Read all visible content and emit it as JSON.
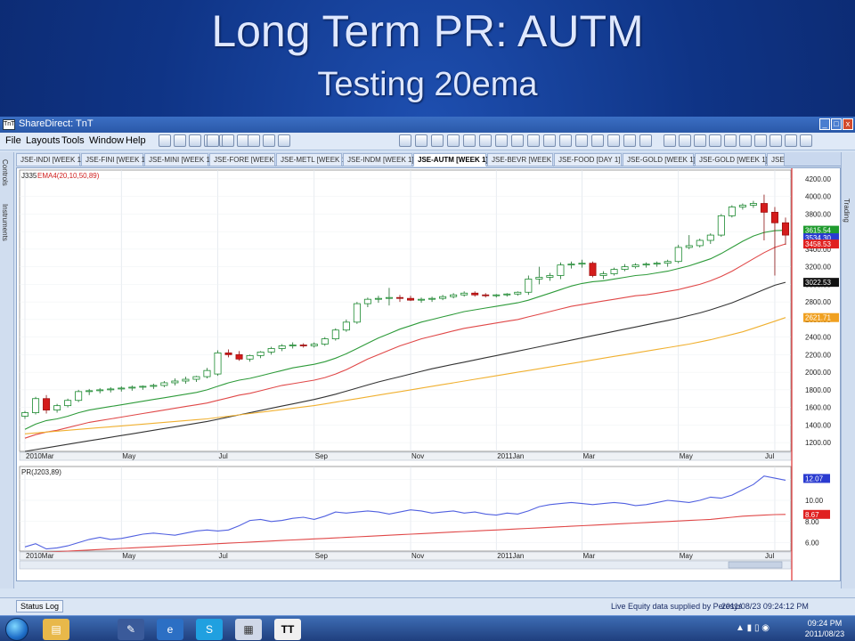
{
  "slide": {
    "title": "Long Term PR: AUTM",
    "subtitle": "Testing 20ema"
  },
  "window": {
    "title": "ShareDirect: TnT",
    "icon_text": "TnT",
    "minimize": "_",
    "maximize": "□",
    "close": "x"
  },
  "menu": [
    "File",
    "Layouts",
    "Tools",
    "Window",
    "Help"
  ],
  "tabs": [
    "JSE-INDI [WEEK 1]",
    "JSE-FINI [WEEK 1]",
    "JSE-MINI [WEEK 1]",
    "JSE-FORE [WEEK 1]",
    "JSE-METL [WEEK 1]",
    "JSE-INDM [WEEK 1]",
    "JSE-AUTM [WEEK 1]",
    "JSE-BEVR [WEEK 1]",
    "JSE-FOOD [DAY 1]",
    "JSE-GOLD [WEEK 1]",
    "JSE-GOLD [WEEK 1]",
    "JSE"
  ],
  "active_tab_index": 6,
  "left_panels": [
    "Controls",
    "Instruments"
  ],
  "right_panels": [
    "Trading"
  ],
  "status": {
    "log_tab": "Status Log",
    "supply": "Live Equity data supplied by Peresys",
    "datetime": "2011/08/23 09:24:12 PM"
  },
  "taskbar": {
    "time": "09:24 PM",
    "date": "2011/08/23"
  },
  "chart_data": [
    {
      "type": "candlestick",
      "symbol_label": "J335",
      "indicator_label": "EMA4(20,10,50,89)",
      "y_ticks": [
        1200,
        1400,
        1600,
        1800,
        2000,
        2200,
        2400,
        2600,
        2800,
        3000,
        3200,
        3400,
        3600,
        3800,
        4000,
        4200
      ],
      "ylim": [
        1100,
        4300
      ],
      "x_ticks": [
        "2010Mar",
        "May",
        "Jul",
        "Sep",
        "Nov",
        "2011Jan",
        "Mar",
        "May",
        "Jul"
      ],
      "candles": [
        {
          "o": 1500,
          "h": 1560,
          "l": 1470,
          "c": 1540
        },
        {
          "o": 1540,
          "h": 1720,
          "l": 1520,
          "c": 1700
        },
        {
          "o": 1700,
          "h": 1740,
          "l": 1530,
          "c": 1570
        },
        {
          "o": 1570,
          "h": 1640,
          "l": 1540,
          "c": 1620
        },
        {
          "o": 1620,
          "h": 1700,
          "l": 1600,
          "c": 1680
        },
        {
          "o": 1680,
          "h": 1800,
          "l": 1660,
          "c": 1780
        },
        {
          "o": 1780,
          "h": 1810,
          "l": 1740,
          "c": 1790
        },
        {
          "o": 1790,
          "h": 1820,
          "l": 1760,
          "c": 1800
        },
        {
          "o": 1800,
          "h": 1830,
          "l": 1770,
          "c": 1810
        },
        {
          "o": 1810,
          "h": 1840,
          "l": 1780,
          "c": 1820
        },
        {
          "o": 1820,
          "h": 1850,
          "l": 1790,
          "c": 1830
        },
        {
          "o": 1830,
          "h": 1850,
          "l": 1800,
          "c": 1840
        },
        {
          "o": 1840,
          "h": 1870,
          "l": 1810,
          "c": 1850
        },
        {
          "o": 1850,
          "h": 1900,
          "l": 1830,
          "c": 1880
        },
        {
          "o": 1880,
          "h": 1930,
          "l": 1850,
          "c": 1900
        },
        {
          "o": 1900,
          "h": 1950,
          "l": 1870,
          "c": 1920
        },
        {
          "o": 1920,
          "h": 1960,
          "l": 1890,
          "c": 1950
        },
        {
          "o": 1950,
          "h": 2050,
          "l": 1930,
          "c": 2020
        },
        {
          "o": 1980,
          "h": 2250,
          "l": 1960,
          "c": 2220
        },
        {
          "o": 2220,
          "h": 2260,
          "l": 2170,
          "c": 2200
        },
        {
          "o": 2200,
          "h": 2240,
          "l": 2130,
          "c": 2150
        },
        {
          "o": 2150,
          "h": 2200,
          "l": 2120,
          "c": 2190
        },
        {
          "o": 2190,
          "h": 2240,
          "l": 2160,
          "c": 2230
        },
        {
          "o": 2230,
          "h": 2290,
          "l": 2200,
          "c": 2270
        },
        {
          "o": 2270,
          "h": 2320,
          "l": 2240,
          "c": 2300
        },
        {
          "o": 2300,
          "h": 2340,
          "l": 2270,
          "c": 2310
        },
        {
          "o": 2310,
          "h": 2330,
          "l": 2280,
          "c": 2300
        },
        {
          "o": 2300,
          "h": 2340,
          "l": 2280,
          "c": 2320
        },
        {
          "o": 2320,
          "h": 2400,
          "l": 2300,
          "c": 2380
        },
        {
          "o": 2380,
          "h": 2500,
          "l": 2360,
          "c": 2480
        },
        {
          "o": 2480,
          "h": 2600,
          "l": 2460,
          "c": 2570
        },
        {
          "o": 2570,
          "h": 2800,
          "l": 2550,
          "c": 2780
        },
        {
          "o": 2780,
          "h": 2850,
          "l": 2740,
          "c": 2830
        },
        {
          "o": 2830,
          "h": 2870,
          "l": 2790,
          "c": 2840
        },
        {
          "o": 2840,
          "h": 2960,
          "l": 2760,
          "c": 2850
        },
        {
          "o": 2850,
          "h": 2880,
          "l": 2800,
          "c": 2840
        },
        {
          "o": 2840,
          "h": 2870,
          "l": 2810,
          "c": 2820
        },
        {
          "o": 2820,
          "h": 2850,
          "l": 2790,
          "c": 2830
        },
        {
          "o": 2830,
          "h": 2860,
          "l": 2800,
          "c": 2840
        },
        {
          "o": 2840,
          "h": 2880,
          "l": 2820,
          "c": 2860
        },
        {
          "o": 2860,
          "h": 2900,
          "l": 2840,
          "c": 2880
        },
        {
          "o": 2880,
          "h": 2920,
          "l": 2860,
          "c": 2900
        },
        {
          "o": 2900,
          "h": 2920,
          "l": 2860,
          "c": 2880
        },
        {
          "o": 2880,
          "h": 2900,
          "l": 2850,
          "c": 2870
        },
        {
          "o": 2870,
          "h": 2890,
          "l": 2850,
          "c": 2880
        },
        {
          "o": 2880,
          "h": 2900,
          "l": 2860,
          "c": 2890
        },
        {
          "o": 2890,
          "h": 2920,
          "l": 2870,
          "c": 2910
        },
        {
          "o": 2910,
          "h": 3100,
          "l": 2880,
          "c": 3060
        },
        {
          "o": 3060,
          "h": 3200,
          "l": 3000,
          "c": 3080
        },
        {
          "o": 3080,
          "h": 3130,
          "l": 3040,
          "c": 3100
        },
        {
          "o": 3100,
          "h": 3250,
          "l": 3060,
          "c": 3220
        },
        {
          "o": 3220,
          "h": 3260,
          "l": 3180,
          "c": 3230
        },
        {
          "o": 3230,
          "h": 3280,
          "l": 3190,
          "c": 3240
        },
        {
          "o": 3240,
          "h": 3260,
          "l": 3080,
          "c": 3100
        },
        {
          "o": 3100,
          "h": 3150,
          "l": 3060,
          "c": 3120
        },
        {
          "o": 3120,
          "h": 3190,
          "l": 3100,
          "c": 3170
        },
        {
          "o": 3170,
          "h": 3230,
          "l": 3150,
          "c": 3200
        },
        {
          "o": 3200,
          "h": 3240,
          "l": 3180,
          "c": 3220
        },
        {
          "o": 3220,
          "h": 3250,
          "l": 3190,
          "c": 3230
        },
        {
          "o": 3230,
          "h": 3260,
          "l": 3200,
          "c": 3240
        },
        {
          "o": 3240,
          "h": 3280,
          "l": 3200,
          "c": 3260
        },
        {
          "o": 3260,
          "h": 3450,
          "l": 3240,
          "c": 3420
        },
        {
          "o": 3420,
          "h": 3560,
          "l": 3400,
          "c": 3440
        },
        {
          "o": 3440,
          "h": 3520,
          "l": 3420,
          "c": 3500
        },
        {
          "o": 3500,
          "h": 3580,
          "l": 3460,
          "c": 3560
        },
        {
          "o": 3560,
          "h": 3800,
          "l": 3540,
          "c": 3780
        },
        {
          "o": 3780,
          "h": 3900,
          "l": 3760,
          "c": 3880
        },
        {
          "o": 3880,
          "h": 3920,
          "l": 3850,
          "c": 3900
        },
        {
          "o": 3900,
          "h": 3950,
          "l": 3870,
          "c": 3920
        },
        {
          "o": 3920,
          "h": 4020,
          "l": 3500,
          "c": 3820
        },
        {
          "o": 3820,
          "h": 3880,
          "l": 3100,
          "c": 3700
        },
        {
          "o": 3700,
          "h": 3760,
          "l": 3450,
          "c": 3560
        }
      ],
      "ema_series": [
        {
          "name": "EMA20",
          "color": "#2e9b3a",
          "values": [
            1350,
            1410,
            1450,
            1470,
            1500,
            1540,
            1570,
            1590,
            1610,
            1630,
            1650,
            1670,
            1690,
            1710,
            1730,
            1750,
            1770,
            1800,
            1840,
            1880,
            1910,
            1930,
            1960,
            1990,
            2020,
            2050,
            2070,
            2090,
            2120,
            2160,
            2210,
            2270,
            2330,
            2390,
            2440,
            2490,
            2530,
            2570,
            2600,
            2630,
            2660,
            2690,
            2710,
            2730,
            2750,
            2770,
            2790,
            2820,
            2860,
            2900,
            2940,
            2980,
            3010,
            3030,
            3040,
            3060,
            3080,
            3100,
            3110,
            3130,
            3150,
            3180,
            3210,
            3250,
            3290,
            3350,
            3420,
            3490,
            3550,
            3590,
            3610,
            3615
          ]
        },
        {
          "name": "EMA50",
          "color": "#e04848",
          "values": [
            1250,
            1290,
            1320,
            1340,
            1370,
            1400,
            1430,
            1450,
            1470,
            1490,
            1510,
            1530,
            1550,
            1570,
            1590,
            1610,
            1630,
            1650,
            1680,
            1710,
            1740,
            1760,
            1790,
            1820,
            1850,
            1870,
            1890,
            1910,
            1940,
            1980,
            2030,
            2090,
            2150,
            2200,
            2250,
            2300,
            2340,
            2380,
            2410,
            2440,
            2470,
            2500,
            2520,
            2540,
            2560,
            2580,
            2600,
            2630,
            2660,
            2690,
            2720,
            2750,
            2770,
            2790,
            2810,
            2830,
            2850,
            2870,
            2880,
            2900,
            2920,
            2940,
            2970,
            3000,
            3040,
            3090,
            3150,
            3220,
            3290,
            3360,
            3420,
            3459
          ]
        },
        {
          "name": "EMA89",
          "color": "#333333",
          "values": [
            1100,
            1120,
            1140,
            1160,
            1180,
            1200,
            1220,
            1240,
            1260,
            1280,
            1300,
            1320,
            1340,
            1360,
            1380,
            1400,
            1420,
            1440,
            1465,
            1490,
            1515,
            1540,
            1565,
            1590,
            1615,
            1640,
            1665,
            1690,
            1720,
            1750,
            1785,
            1820,
            1855,
            1890,
            1920,
            1950,
            1980,
            2010,
            2040,
            2065,
            2090,
            2115,
            2140,
            2165,
            2190,
            2215,
            2240,
            2265,
            2290,
            2315,
            2340,
            2365,
            2390,
            2415,
            2440,
            2465,
            2490,
            2515,
            2540,
            2565,
            2590,
            2615,
            2645,
            2675,
            2710,
            2750,
            2790,
            2840,
            2890,
            2940,
            2990,
            3023
          ]
        },
        {
          "name": "EMA200",
          "color": "#f0b030",
          "values": [
            1300,
            1310,
            1320,
            1330,
            1340,
            1350,
            1360,
            1370,
            1380,
            1390,
            1400,
            1410,
            1420,
            1430,
            1440,
            1450,
            1460,
            1470,
            1485,
            1500,
            1515,
            1530,
            1545,
            1560,
            1575,
            1590,
            1605,
            1620,
            1640,
            1660,
            1680,
            1700,
            1720,
            1740,
            1760,
            1780,
            1800,
            1820,
            1840,
            1860,
            1880,
            1900,
            1920,
            1940,
            1960,
            1980,
            2000,
            2020,
            2040,
            2060,
            2080,
            2100,
            2120,
            2140,
            2160,
            2180,
            2200,
            2220,
            2240,
            2260,
            2280,
            2300,
            2320,
            2345,
            2370,
            2400,
            2430,
            2460,
            2500,
            2540,
            2580,
            2622
          ]
        }
      ],
      "price_labels": [
        {
          "value": 3615.54,
          "text": "3615.54",
          "color": "#1f9b2e"
        },
        {
          "value": 3530,
          "text": "3534.30",
          "color": "#2a3bd0"
        },
        {
          "value": 3458.53,
          "text": "3458.53",
          "color": "#e02020"
        },
        {
          "value": 3022.53,
          "text": "3022.53",
          "color": "#111111"
        },
        {
          "value": 2621.71,
          "text": "2621.71",
          "color": "#f0a020"
        }
      ]
    },
    {
      "type": "line",
      "indicator_label": "PR(J203,89)",
      "y_ticks": [
        6.0,
        8.0,
        10.0,
        12.0
      ],
      "y_tick_labels": [
        "6.00",
        "8.00",
        "10.00",
        "12.00"
      ],
      "ylim": [
        5.2,
        13.2
      ],
      "series": [
        {
          "name": "PR",
          "color": "#5060e0",
          "values": [
            5.6,
            5.9,
            5.4,
            5.5,
            5.7,
            6.0,
            6.3,
            6.5,
            6.3,
            6.4,
            6.6,
            6.8,
            6.9,
            6.8,
            6.7,
            6.9,
            7.1,
            7.2,
            7.1,
            7.2,
            7.6,
            8.1,
            8.2,
            8.0,
            8.1,
            8.3,
            8.4,
            8.2,
            8.5,
            8.9,
            8.8,
            8.9,
            9.0,
            8.9,
            8.7,
            8.9,
            9.1,
            9.0,
            8.8,
            8.9,
            9.0,
            8.8,
            8.9,
            8.7,
            8.6,
            8.8,
            8.7,
            9.0,
            9.4,
            9.6,
            9.7,
            9.8,
            9.7,
            9.6,
            9.7,
            9.8,
            9.7,
            9.5,
            9.6,
            9.8,
            10.0,
            9.9,
            9.8,
            10.0,
            10.3,
            10.2,
            10.5,
            11.0,
            11.5,
            12.3,
            12.1,
            11.9
          ]
        },
        {
          "name": "Signal",
          "color": "#e04848",
          "values": [
            5.0,
            5.05,
            5.1,
            5.15,
            5.2,
            5.25,
            5.3,
            5.35,
            5.4,
            5.45,
            5.5,
            5.55,
            5.6,
            5.65,
            5.7,
            5.75,
            5.8,
            5.85,
            5.9,
            5.95,
            6.0,
            6.05,
            6.1,
            6.15,
            6.2,
            6.25,
            6.3,
            6.35,
            6.4,
            6.45,
            6.5,
            6.55,
            6.6,
            6.65,
            6.7,
            6.75,
            6.8,
            6.85,
            6.9,
            6.95,
            7.0,
            7.05,
            7.1,
            7.15,
            7.2,
            7.25,
            7.3,
            7.35,
            7.4,
            7.45,
            7.5,
            7.55,
            7.6,
            7.65,
            7.7,
            7.75,
            7.8,
            7.85,
            7.9,
            7.95,
            8.0,
            8.05,
            8.1,
            8.15,
            8.2,
            8.3,
            8.4,
            8.5,
            8.55,
            8.6,
            8.65,
            8.67
          ]
        }
      ],
      "value_labels": [
        {
          "value": 12.07,
          "text": "12.07",
          "color": "#2a3bd0"
        },
        {
          "value": 8.67,
          "text": "8.67",
          "color": "#e02020"
        }
      ],
      "x_ticks": [
        "2010Mar",
        "May",
        "Jul",
        "Sep",
        "Nov",
        "2011Jan",
        "Mar",
        "May",
        "Jul"
      ]
    }
  ]
}
